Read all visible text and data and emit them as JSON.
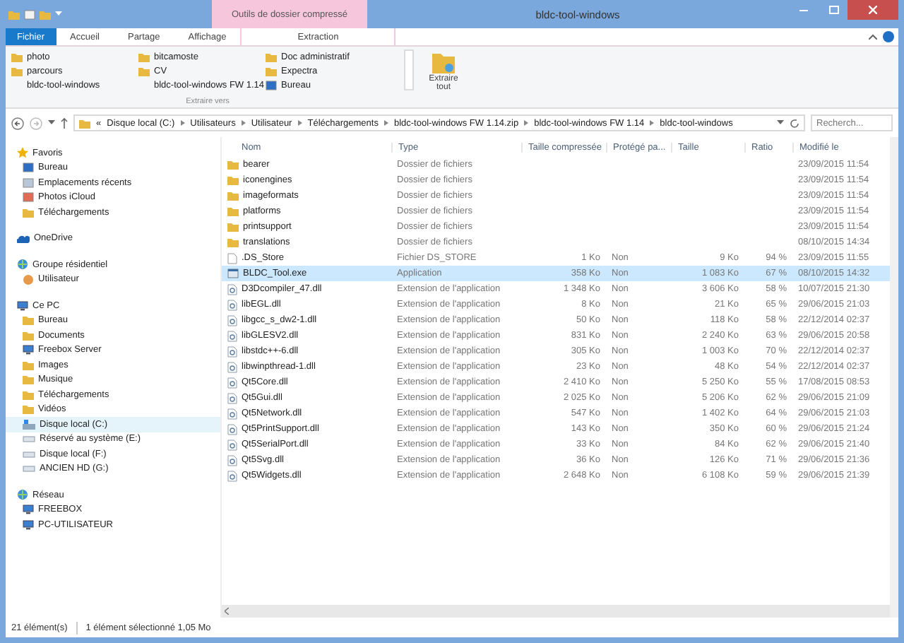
{
  "window": {
    "title": "bldc-tool-windows",
    "context_tab": "Outils de dossier compressé"
  },
  "ribbon": {
    "tabs": [
      {
        "label": "Fichier",
        "kind": "file",
        "selected": false
      },
      {
        "label": "Accueil",
        "kind": "tab",
        "selected": false
      },
      {
        "label": "Partage",
        "kind": "tab",
        "selected": false
      },
      {
        "label": "Affichage",
        "kind": "tab",
        "selected": false
      },
      {
        "label": "Extraction",
        "kind": "tab",
        "selected": true
      }
    ],
    "destinations": [
      {
        "label": "photo",
        "kind": "folder"
      },
      {
        "label": "parcours",
        "kind": "folder"
      },
      {
        "label": "bldc-tool-windows",
        "kind": "plain"
      },
      {
        "label": "bitcamoste",
        "kind": "folder"
      },
      {
        "label": "CV",
        "kind": "folder"
      },
      {
        "label": "bldc-tool-windows FW 1.14",
        "kind": "plain"
      },
      {
        "label": "Doc administratif",
        "kind": "folder"
      },
      {
        "label": "Expectra",
        "kind": "folder"
      },
      {
        "label": "Bureau",
        "kind": "desktop"
      }
    ],
    "group_label": "Extraire vers",
    "extract_all": "Extraire tout"
  },
  "address": {
    "path": [
      "«",
      "Disque local (C:)",
      "Utilisateurs",
      "Utilisateur",
      "Téléchargements",
      "bldc-tool-windows FW 1.14.zip",
      "bldc-tool-windows FW 1.14",
      "bldc-tool-windows"
    ],
    "search": {
      "placeholder": "Recherch..."
    }
  },
  "sidebar": {
    "items": [
      {
        "label": "Favoris",
        "kind": "star",
        "children": [
          {
            "label": "Bureau",
            "kind": "desktop"
          },
          {
            "label": "Emplacements récents",
            "kind": "recent"
          },
          {
            "label": "Photos iCloud",
            "kind": "photos"
          },
          {
            "label": "Téléchargements",
            "kind": "folder"
          }
        ]
      },
      {
        "label": "OneDrive",
        "kind": "cloud"
      },
      {
        "label": "Groupe résidentiel",
        "kind": "home",
        "children": [
          {
            "label": "Utilisateur",
            "kind": "user"
          }
        ]
      },
      {
        "label": "Ce PC",
        "kind": "pc",
        "children": [
          {
            "label": "Bureau",
            "kind": "folder"
          },
          {
            "label": "Documents",
            "kind": "folder"
          },
          {
            "label": "Freebox Server",
            "kind": "server"
          },
          {
            "label": "Images",
            "kind": "folder"
          },
          {
            "label": "Musique",
            "kind": "folder"
          },
          {
            "label": "Téléchargements",
            "kind": "folder"
          },
          {
            "label": "Vidéos",
            "kind": "folder"
          },
          {
            "label": "Disque local (C:)",
            "kind": "sysdrive",
            "selected": true
          },
          {
            "label": "Réservé au système (E:)",
            "kind": "drive",
            "selected": false
          },
          {
            "label": "Disque local (F:)",
            "kind": "drive",
            "selected": false
          },
          {
            "label": "ANCIEN HD (G:)",
            "kind": "drive",
            "selected": false
          }
        ]
      },
      {
        "label": "Réseau",
        "kind": "network",
        "children": [
          {
            "label": "FREEBOX",
            "kind": "computer"
          },
          {
            "label": "PC-UTILISATEUR",
            "kind": "computer"
          }
        ]
      }
    ]
  },
  "table": {
    "columns": [
      "Nom",
      "Type",
      "Taille compressée",
      "Protégé pa...",
      "Taille",
      "Ratio",
      "Modifié le"
    ],
    "rows": [
      {
        "kind": "folder",
        "selected": false,
        "cells": [
          "bearer",
          "Dossier de fichiers",
          "",
          "",
          "",
          "",
          "23/09/2015 11:54"
        ]
      },
      {
        "kind": "folder",
        "selected": false,
        "cells": [
          "iconengines",
          "Dossier de fichiers",
          "",
          "",
          "",
          "",
          "23/09/2015 11:54"
        ]
      },
      {
        "kind": "folder",
        "selected": false,
        "cells": [
          "imageformats",
          "Dossier de fichiers",
          "",
          "",
          "",
          "",
          "23/09/2015 11:54"
        ]
      },
      {
        "kind": "folder",
        "selected": false,
        "cells": [
          "platforms",
          "Dossier de fichiers",
          "",
          "",
          "",
          "",
          "23/09/2015 11:54"
        ]
      },
      {
        "kind": "folder",
        "selected": false,
        "cells": [
          "printsupport",
          "Dossier de fichiers",
          "",
          "",
          "",
          "",
          "23/09/2015 11:54"
        ]
      },
      {
        "kind": "folder",
        "selected": false,
        "cells": [
          "translations",
          "Dossier de fichiers",
          "",
          "",
          "",
          "",
          "08/10/2015 14:34"
        ]
      },
      {
        "kind": "file",
        "selected": false,
        "cells": [
          ".DS_Store",
          "Fichier DS_STORE",
          "1 Ko",
          "Non",
          "9 Ko",
          "94 %",
          "23/09/2015 11:55"
        ]
      },
      {
        "kind": "exe",
        "selected": true,
        "cells": [
          "BLDC_Tool.exe",
          "Application",
          "358 Ko",
          "Non",
          "1 083 Ko",
          "67 %",
          "08/10/2015 14:32"
        ]
      },
      {
        "kind": "dll",
        "selected": false,
        "cells": [
          "D3Dcompiler_47.dll",
          "Extension de l'application",
          "1 348 Ko",
          "Non",
          "3 606 Ko",
          "58 %",
          "10/07/2015 21:30"
        ]
      },
      {
        "kind": "dll",
        "selected": false,
        "cells": [
          "libEGL.dll",
          "Extension de l'application",
          "8 Ko",
          "Non",
          "21 Ko",
          "65 %",
          "29/06/2015 21:03"
        ]
      },
      {
        "kind": "dll",
        "selected": false,
        "cells": [
          "libgcc_s_dw2-1.dll",
          "Extension de l'application",
          "50 Ko",
          "Non",
          "118 Ko",
          "58 %",
          "22/12/2014 02:37"
        ]
      },
      {
        "kind": "dll",
        "selected": false,
        "cells": [
          "libGLESV2.dll",
          "Extension de l'application",
          "831 Ko",
          "Non",
          "2 240 Ko",
          "63 %",
          "29/06/2015 20:58"
        ]
      },
      {
        "kind": "dll",
        "selected": false,
        "cells": [
          "libstdc++-6.dll",
          "Extension de l'application",
          "305 Ko",
          "Non",
          "1 003 Ko",
          "70 %",
          "22/12/2014 02:37"
        ]
      },
      {
        "kind": "dll",
        "selected": false,
        "cells": [
          "libwinpthread-1.dll",
          "Extension de l'application",
          "23 Ko",
          "Non",
          "48 Ko",
          "54 %",
          "22/12/2014 02:37"
        ]
      },
      {
        "kind": "dll",
        "selected": false,
        "cells": [
          "Qt5Core.dll",
          "Extension de l'application",
          "2 410 Ko",
          "Non",
          "5 250 Ko",
          "55 %",
          "17/08/2015 08:53"
        ]
      },
      {
        "kind": "dll",
        "selected": false,
        "cells": [
          "Qt5Gui.dll",
          "Extension de l'application",
          "2 025 Ko",
          "Non",
          "5 206 Ko",
          "62 %",
          "29/06/2015 21:09"
        ]
      },
      {
        "kind": "dll",
        "selected": false,
        "cells": [
          "Qt5Network.dll",
          "Extension de l'application",
          "547 Ko",
          "Non",
          "1 402 Ko",
          "64 %",
          "29/06/2015 21:03"
        ]
      },
      {
        "kind": "dll",
        "selected": false,
        "cells": [
          "Qt5PrintSupport.dll",
          "Extension de l'application",
          "143 Ko",
          "Non",
          "350 Ko",
          "60 %",
          "29/06/2015 21:24"
        ]
      },
      {
        "kind": "dll",
        "selected": false,
        "cells": [
          "Qt5SerialPort.dll",
          "Extension de l'application",
          "33 Ko",
          "Non",
          "84 Ko",
          "62 %",
          "29/06/2015 21:40"
        ]
      },
      {
        "kind": "dll",
        "selected": false,
        "cells": [
          "Qt5Svg.dll",
          "Extension de l'application",
          "36 Ko",
          "Non",
          "126 Ko",
          "71 %",
          "29/06/2015 21:36"
        ]
      },
      {
        "kind": "dll",
        "selected": false,
        "cells": [
          "Qt5Widgets.dll",
          "Extension de l'application",
          "2 648 Ko",
          "Non",
          "6 108 Ko",
          "59 %",
          "29/06/2015 21:39"
        ]
      }
    ]
  },
  "status_bar": {
    "count": "21 élément(s)",
    "selection": "1 élément sélectionné  1,05 Mo"
  }
}
